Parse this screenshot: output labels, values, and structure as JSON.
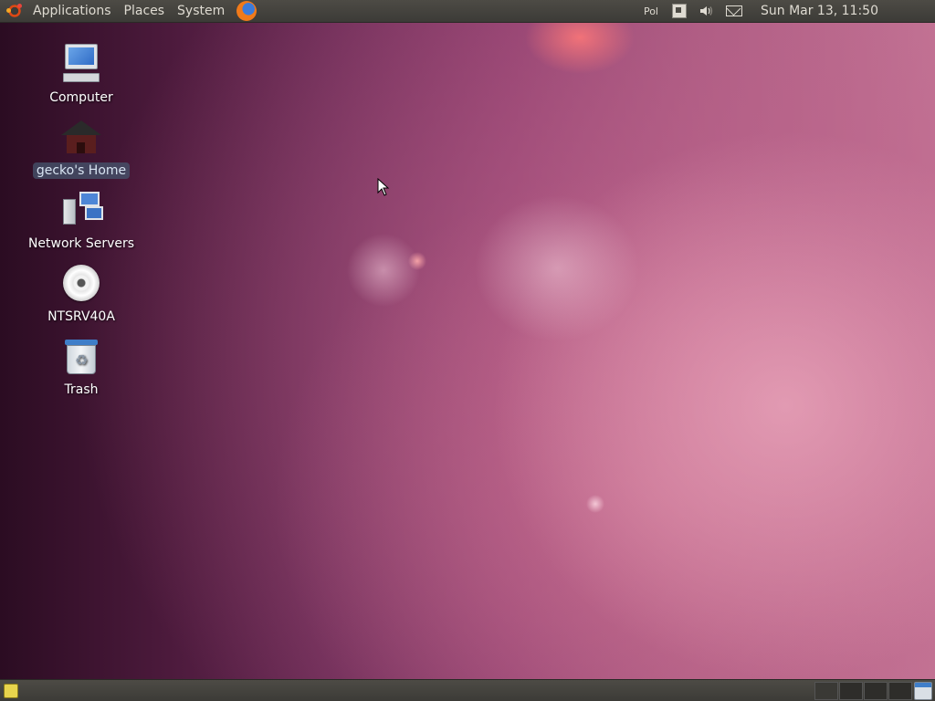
{
  "top_panel": {
    "menus": [
      {
        "label": "Applications"
      },
      {
        "label": "Places"
      },
      {
        "label": "System"
      }
    ],
    "keyboard_layout": "Pol",
    "clock": "Sun Mar 13, 11:50",
    "icons": [
      "ubuntu-logo-icon",
      "firefox-icon",
      "network-icon",
      "volume-icon",
      "mail-icon"
    ]
  },
  "desktop": {
    "icons": [
      {
        "label": "Computer",
        "icon": "computer-icon"
      },
      {
        "label": "gecko's Home",
        "icon": "home-folder-icon",
        "selected": true
      },
      {
        "label": "Network Servers",
        "icon": "network-servers-icon"
      },
      {
        "label": "NTSRV40A",
        "icon": "cd-drive-icon"
      },
      {
        "label": "Trash",
        "icon": "trash-icon"
      }
    ]
  },
  "bottom_panel": {
    "workspaces": 4,
    "active_workspace": 1,
    "icons": [
      "show-desktop-icon",
      "trash-applet-icon"
    ]
  },
  "colors": {
    "panel": "#3c3b37",
    "panel_text": "#dfdbd2",
    "selection": "#46556e",
    "accent": "#dd4814"
  }
}
